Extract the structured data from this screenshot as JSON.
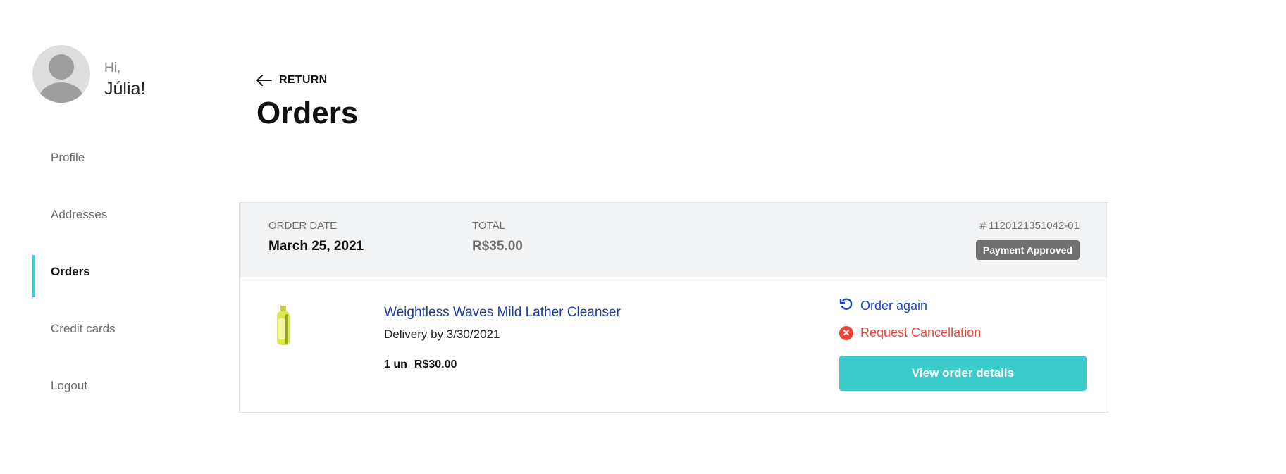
{
  "user": {
    "greeting": "Hi,",
    "name": "Júlia!"
  },
  "sidebar": {
    "items": [
      {
        "label": "Profile",
        "active": false
      },
      {
        "label": "Addresses",
        "active": false
      },
      {
        "label": "Orders",
        "active": true
      },
      {
        "label": "Credit cards",
        "active": false
      },
      {
        "label": "Logout",
        "active": false
      }
    ]
  },
  "header": {
    "return_label": "RETURN",
    "title": "Orders"
  },
  "order": {
    "date_label": "ORDER DATE",
    "date": "March 25, 2021",
    "total_label": "TOTAL",
    "total": "R$35.00",
    "number": "# 1120121351042-01",
    "status": "Payment Approved",
    "item": {
      "name": "Weightless Waves Mild Lather Cleanser",
      "delivery": "Delivery by 3/30/2021",
      "quantity": "1 un",
      "price": "R$30.00"
    },
    "actions": {
      "order_again": "Order again",
      "request_cancellation": "Request Cancellation",
      "view_details": "View order details"
    }
  },
  "colors": {
    "accent": "#3ccbcb",
    "link": "#1b3e9b",
    "danger": "#e8453c",
    "badge": "#707070"
  },
  "icons": [
    "user-avatar-icon",
    "arrow-left-icon",
    "refresh-icon",
    "x-circle-icon"
  ]
}
